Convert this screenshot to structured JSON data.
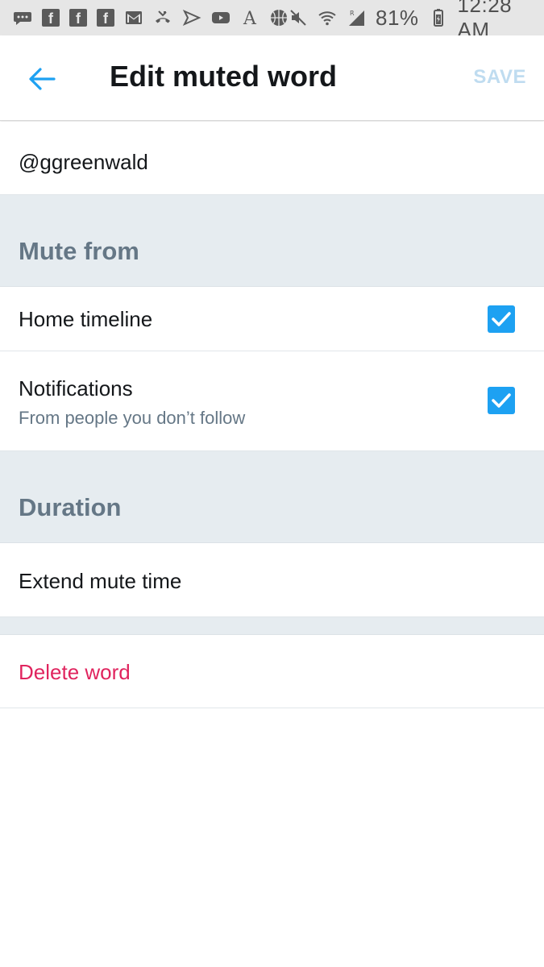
{
  "status_bar": {
    "battery_percent": "81%",
    "time": "12:28 AM",
    "icons_left": [
      "messages-icon",
      "facebook-icon",
      "facebook-icon",
      "facebook-icon",
      "gmail-icon",
      "missed-call-icon",
      "sprint-icon",
      "youtube-icon",
      "font-icon",
      "basketball-icon"
    ],
    "icons_right": [
      "mute-icon",
      "wifi-icon",
      "signal-icon",
      "battery-icon"
    ]
  },
  "header": {
    "title": "Edit muted word",
    "save_label": "SAVE"
  },
  "muted_word": "@ggreenwald",
  "mute_from": {
    "title": "Mute from",
    "home_timeline": {
      "label": "Home timeline",
      "checked": true
    },
    "notifications": {
      "label": "Notifications",
      "sublabel": "From people you don’t follow",
      "checked": true
    }
  },
  "duration": {
    "title": "Duration",
    "extend_label": "Extend mute time"
  },
  "delete_label": "Delete word",
  "colors": {
    "accent": "#1da1f2",
    "danger": "#e0245e",
    "section_bg": "#e6ecf0",
    "muted_text": "#657786"
  }
}
